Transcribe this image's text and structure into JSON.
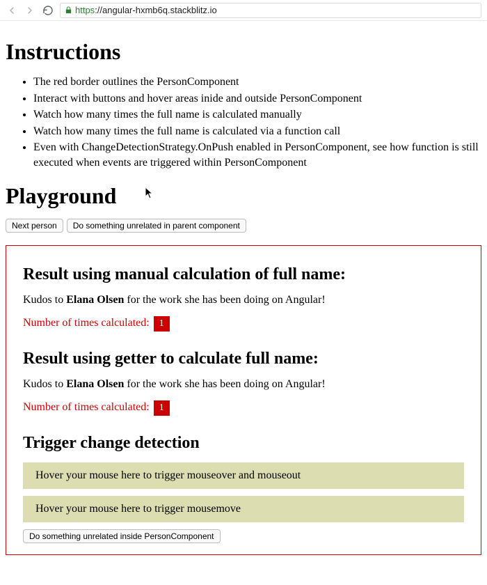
{
  "browser": {
    "url_scheme": "https",
    "url_rest": "://angular-hxmb6q.stackblitz.io"
  },
  "headings": {
    "instructions": "Instructions",
    "playground": "Playground"
  },
  "instructions": {
    "items": [
      "The red border outlines the PersonComponent",
      "Interact with buttons and hover areas inide and outside PersonComponent",
      "Watch how many times the full name is calculated manually",
      "Watch how many times the full name is calculated via a function call",
      "Even with ChangeDetectionStrategy.OnPush enabled in PersonComponent, see how function is still executed when events are triggered within PersonComponent"
    ]
  },
  "buttons": {
    "next_person": "Next person",
    "do_unrelated_parent": "Do something unrelated in parent component",
    "do_unrelated_inside": "Do something unrelated inside PersonComponent"
  },
  "section_manual": {
    "heading": "Result using manual calculation of full name:",
    "kudos_prefix": "Kudos to ",
    "person_name": "Elana Olsen",
    "kudos_suffix": " for the work she has been doing on Angular!",
    "count_label": "Number of times calculated: ",
    "count_value": "1"
  },
  "section_getter": {
    "heading": "Result using getter to calculate full name:",
    "kudos_prefix": "Kudos to ",
    "person_name": "Elana Olsen",
    "kudos_suffix": " for the work she has been doing on Angular!",
    "count_label": "Number of times calculated: ",
    "count_value": "1"
  },
  "section_trigger": {
    "heading": "Trigger change detection",
    "hover1": "Hover your mouse here to trigger mouseover and mouseout",
    "hover2": "Hover your mouse here to trigger mousemove"
  }
}
